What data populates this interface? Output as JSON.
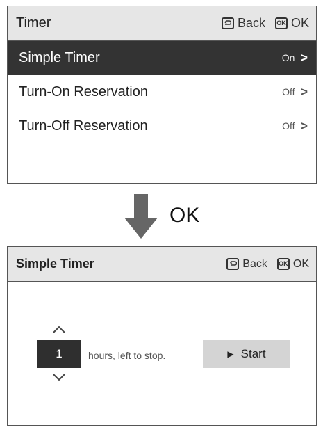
{
  "menu": {
    "title": "Timer",
    "back_label": "Back",
    "ok_label": "OK",
    "items": [
      {
        "label": "Simple Timer",
        "state": "On",
        "selected": true
      },
      {
        "label": "Turn-On Reservation",
        "state": "Off",
        "selected": false
      },
      {
        "label": "Turn-Off Reservation",
        "state": "Off",
        "selected": false
      }
    ]
  },
  "transition": {
    "label": "OK",
    "icon": "down-arrow-icon"
  },
  "simple_timer": {
    "title": "Simple Timer",
    "back_label": "Back",
    "ok_label": "OK",
    "hours_value": "1",
    "hours_text": "hours, left to stop.",
    "start_label": "Start"
  },
  "icons": {
    "ok_box_text": "OK"
  },
  "colors": {
    "selected_row": "#333333",
    "header_bg": "#e6e6e6",
    "start_button": "#d4d4d4",
    "arrow": "#666666"
  }
}
